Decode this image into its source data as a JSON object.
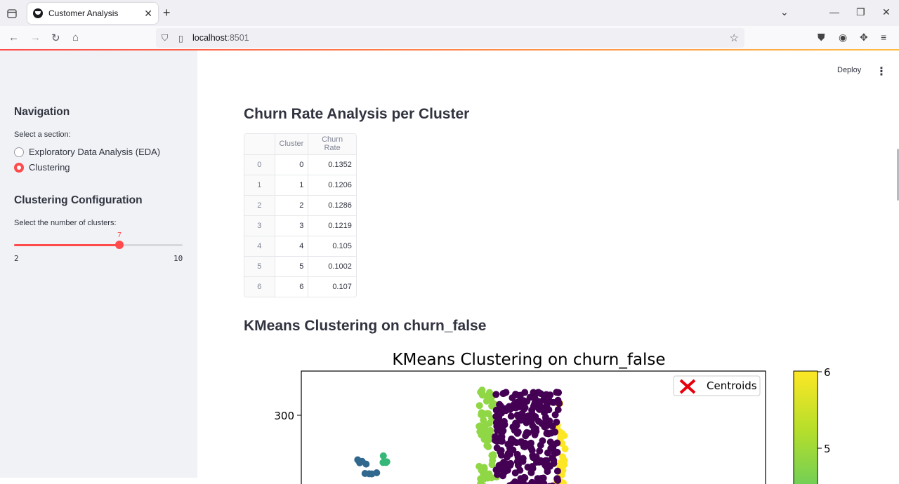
{
  "browser": {
    "tab_title": "Customer Analysis",
    "url_host": "localhost",
    "url_port": ":8501"
  },
  "sidebar": {
    "nav_heading": "Navigation",
    "section_label": "Select a section:",
    "options": [
      {
        "label": "Exploratory Data Analysis (EDA)",
        "selected": false
      },
      {
        "label": "Clustering",
        "selected": true
      }
    ],
    "config_heading": "Clustering Configuration",
    "slider_label": "Select the number of clusters:",
    "slider": {
      "min": 2,
      "max": 10,
      "value": 7,
      "min_label": "2",
      "max_label": "10",
      "value_label": "7"
    }
  },
  "header": {
    "deploy_label": "Deploy",
    "menu_icon": "kebab-icon"
  },
  "main": {
    "churn_heading": "Churn Rate Analysis per Cluster",
    "table": {
      "columns": [
        "",
        "Cluster",
        "Churn Rate"
      ],
      "rows": [
        [
          "0",
          "0",
          "0.1352"
        ],
        [
          "1",
          "1",
          "0.1206"
        ],
        [
          "2",
          "2",
          "0.1286"
        ],
        [
          "3",
          "3",
          "0.1219"
        ],
        [
          "4",
          "4",
          "0.105"
        ],
        [
          "5",
          "5",
          "0.1002"
        ],
        [
          "6",
          "6",
          "0.107"
        ]
      ]
    },
    "kmeans_heading": "KMeans Clustering on churn_false"
  },
  "chart_data": {
    "type": "scatter",
    "title": "KMeans Clustering on churn_false",
    "legend": [
      "Centroids"
    ],
    "legend_position": "top-right",
    "ytick_labels": [
      "300"
    ],
    "colorbar_tick_labels": [
      "6",
      "5"
    ],
    "colormap": "viridis",
    "colors": {
      "purple": "#440154",
      "yellow": "#fde725",
      "lightgreen": "#8fd744",
      "teal": "#21918c",
      "green": "#35b779",
      "blue": "#31688e",
      "centroid": "#e8000b"
    }
  }
}
